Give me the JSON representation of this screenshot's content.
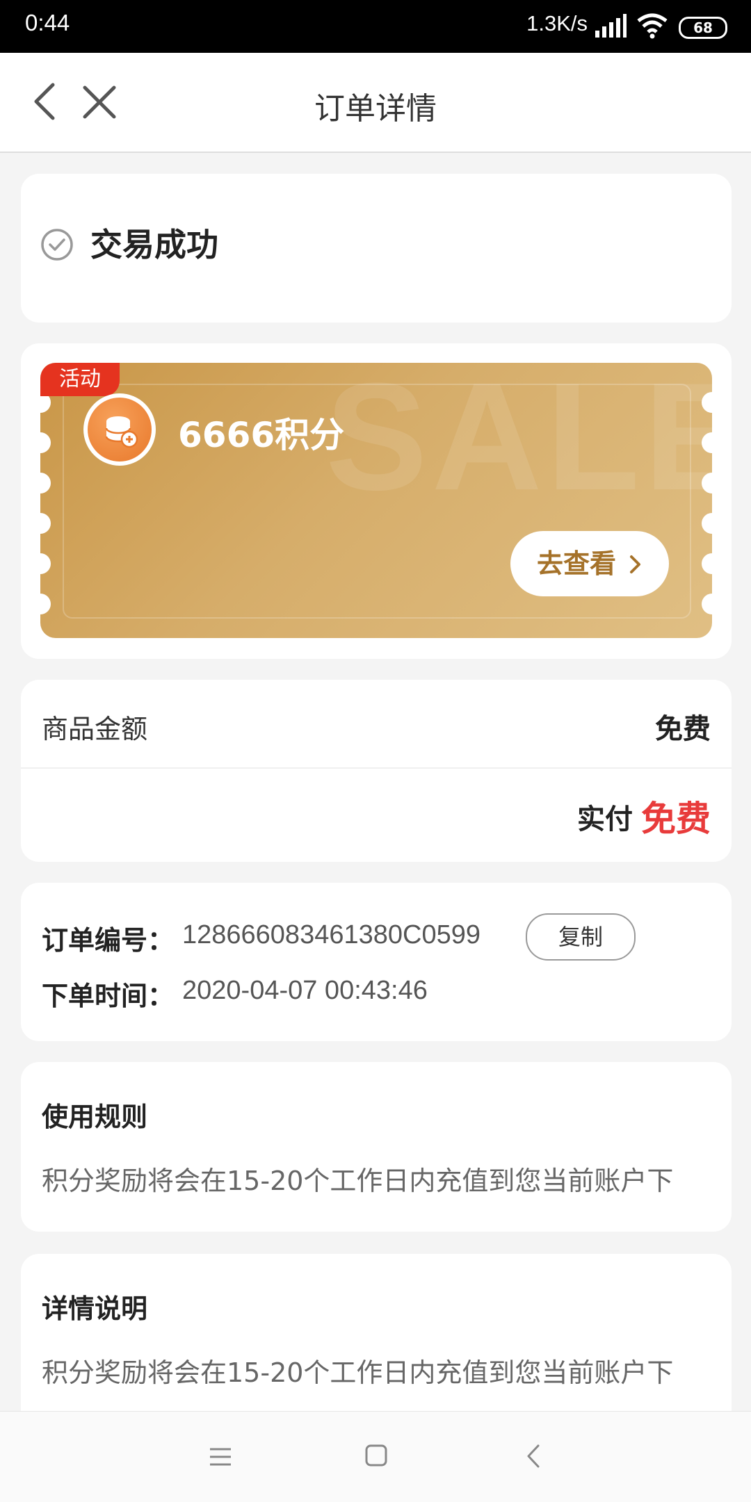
{
  "status_bar": {
    "time": "0:44",
    "network_speed": "1.3K/s",
    "battery": "68"
  },
  "nav": {
    "title": "订单详情"
  },
  "order_status": {
    "text": "交易成功"
  },
  "reward": {
    "tag": "活动",
    "points": "6666积分",
    "view_button": "去查看",
    "watermark": "SALE"
  },
  "amount": {
    "goods_label": "商品金额",
    "goods_value": "免费",
    "paid_label": "实付",
    "paid_value": "免费"
  },
  "order_info": {
    "number_label": "订单编号：",
    "number_value": "128666083461380C0599",
    "copy_button": "复制",
    "time_label": "下单时间：",
    "time_value": "2020-04-07 00:43:46"
  },
  "rules": {
    "title": "使用规则",
    "body": "积分奖励将会在15-20个工作日内充值到您当前账户下"
  },
  "details": {
    "title": "详情说明",
    "body": "积分奖励将会在15-20个工作日内充值到您当前账户下"
  },
  "colors": {
    "accent_red": "#e83b3b",
    "coupon_gold": "#d6ad6a",
    "tag_red": "#e5331f",
    "button_text_gold": "#a5722a"
  }
}
